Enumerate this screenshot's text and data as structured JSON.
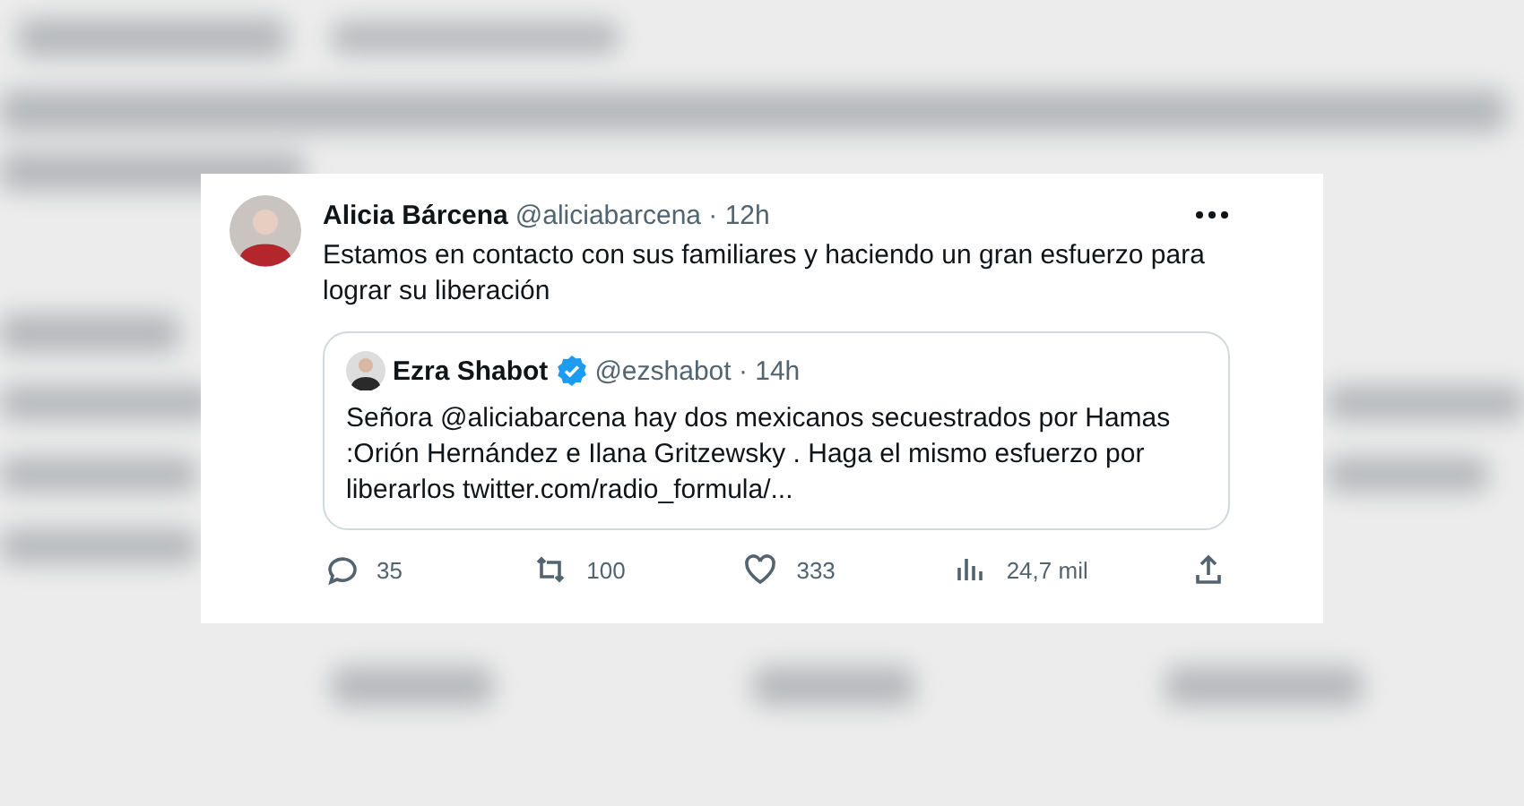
{
  "tweet": {
    "author": {
      "name": "Alicia Bárcena",
      "meta": "@aliciabarcena · 12h"
    },
    "text": "Estamos en contacto con sus familiares y haciendo un gran esfuerzo para lograr su liberación",
    "quoted": {
      "name": "Ezra Shabot",
      "verified": true,
      "meta": "@ezshabot · 14h",
      "text": "Señora @aliciabarcena hay dos mexicanos secuestrados por Hamas :Orión Hernández e Ilana Gritzewsky . Haga el mismo esfuerzo por liberarlos twitter.com/radio_formula/..."
    },
    "actions": [
      {
        "kind": "reply",
        "count": "35"
      },
      {
        "kind": "retweet",
        "count": "100"
      },
      {
        "kind": "like",
        "count": "333"
      },
      {
        "kind": "views",
        "count": "24,7 mil"
      },
      {
        "kind": "share"
      }
    ]
  }
}
